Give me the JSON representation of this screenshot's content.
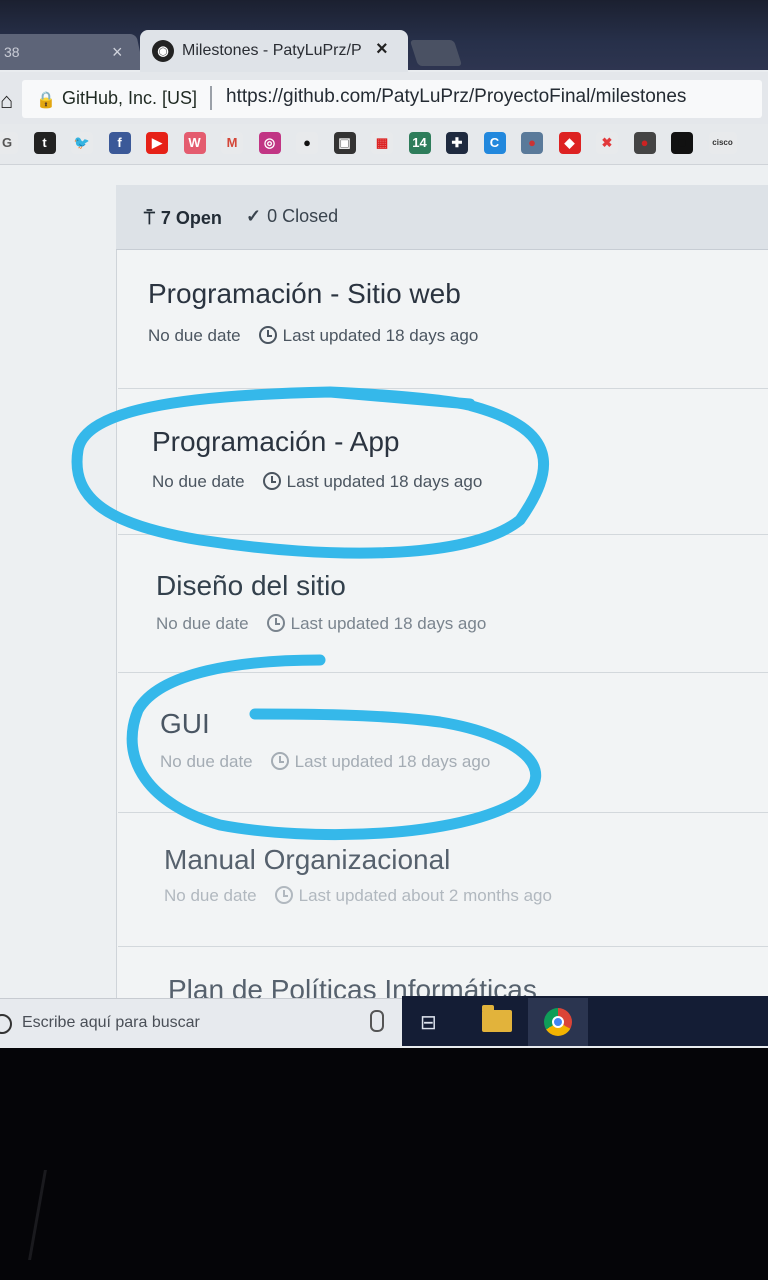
{
  "browser": {
    "prev_tab_label": "38",
    "prev_tab_close": "×",
    "active_tab": {
      "icon": "github-icon",
      "title": "Milestones - PatyLuPrz/Pr",
      "close": "×"
    },
    "site_identity": "GitHub, Inc. [US]",
    "url": "https://github.com/PatyLuPrz/ProyectoFinal/milestones"
  },
  "bookmarks": [
    {
      "icon": "google-icon",
      "glyph": "G",
      "color": "#e8eaec",
      "text": "#555"
    },
    {
      "icon": "tumblr-icon",
      "glyph": "t",
      "color": "#222",
      "text": "#fff"
    },
    {
      "icon": "twitter-icon",
      "glyph": "🐦",
      "color": "#e8eaec",
      "text": "#1da1f2"
    },
    {
      "icon": "facebook-icon",
      "glyph": "f",
      "color": "#3b5998",
      "text": "#fff"
    },
    {
      "icon": "youtube-icon",
      "glyph": "▶",
      "color": "#e62117",
      "text": "#fff"
    },
    {
      "icon": "scribd-icon",
      "glyph": "W",
      "color": "#e45c6f",
      "text": "#fff"
    },
    {
      "icon": "gmail-icon",
      "glyph": "M",
      "color": "#e8eaec",
      "text": "#d44638"
    },
    {
      "icon": "instagram-icon",
      "glyph": "◎",
      "color": "#c13584",
      "text": "#fff"
    },
    {
      "icon": "github-icon",
      "glyph": "●",
      "color": "#e8eaec",
      "text": "#111"
    },
    {
      "icon": "bookmark-icon",
      "glyph": "▣",
      "color": "#333",
      "text": "#fff"
    },
    {
      "icon": "grid-icon",
      "glyph": "▦",
      "color": "#e8eaec",
      "text": "#d22"
    },
    {
      "icon": "badge-14-icon",
      "glyph": "14",
      "color": "#2e7d5b",
      "text": "#fff"
    },
    {
      "icon": "plus-icon",
      "glyph": "✚",
      "color": "#1e2a3f",
      "text": "#fff"
    },
    {
      "icon": "c-icon",
      "glyph": "C",
      "color": "#2288dd",
      "text": "#fff"
    },
    {
      "icon": "globe-icon",
      "glyph": "●",
      "color": "#5a7a9a",
      "text": "#c33"
    },
    {
      "icon": "red-tag-icon",
      "glyph": "◆",
      "color": "#d22",
      "text": "#fff"
    },
    {
      "icon": "joomla-icon",
      "glyph": "✖",
      "color": "#e8eaec",
      "text": "#e2393b"
    },
    {
      "icon": "dark-circle-icon",
      "glyph": "●",
      "color": "#444",
      "text": "#c22"
    },
    {
      "icon": "black-square-icon",
      "glyph": "■",
      "color": "#111",
      "text": "#111"
    },
    {
      "icon": "cisco-icon",
      "glyph": "cisco",
      "color": "#e8eaec",
      "text": "#333"
    }
  ],
  "milestones": {
    "open_label": "7 Open",
    "closed_label": "0 Closed",
    "items": [
      {
        "title": "Programación - Sitio web",
        "due": "No due date",
        "updated": "Last updated 18 days ago"
      },
      {
        "title": "Programación - App",
        "due": "No due date",
        "updated": "Last updated 18 days ago"
      },
      {
        "title": "Diseño del sitio",
        "due": "No due date",
        "updated": "Last updated 18 days ago"
      },
      {
        "title": "GUI",
        "due": "No due date",
        "updated": "Last updated 18 days ago"
      },
      {
        "title": "Manual Organizacional",
        "due": "No due date",
        "updated": "Last updated about 2 months ago"
      },
      {
        "title": "Plan de Políticas Informáticas",
        "due": "",
        "updated": ""
      }
    ]
  },
  "taskbar": {
    "search_placeholder": "Escribe aquí para buscar",
    "ink_color": "#35b8ea"
  }
}
